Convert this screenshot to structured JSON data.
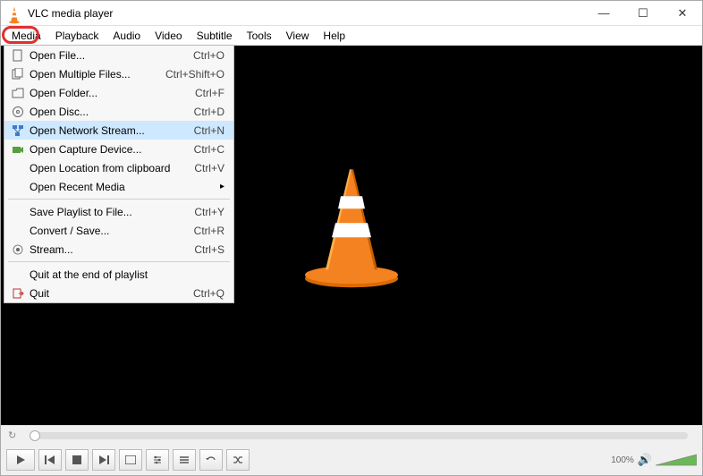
{
  "window": {
    "title": "VLC media player"
  },
  "menubar": {
    "items": [
      {
        "label": "Media",
        "active": true
      },
      {
        "label": "Playback"
      },
      {
        "label": "Audio"
      },
      {
        "label": "Video"
      },
      {
        "label": "Subtitle"
      },
      {
        "label": "Tools"
      },
      {
        "label": "View"
      },
      {
        "label": "Help"
      }
    ]
  },
  "dropdown": {
    "open_file": {
      "label": "Open File...",
      "shortcut": "Ctrl+O"
    },
    "open_multiple": {
      "label": "Open Multiple Files...",
      "shortcut": "Ctrl+Shift+O"
    },
    "open_folder": {
      "label": "Open Folder...",
      "shortcut": "Ctrl+F"
    },
    "open_disc": {
      "label": "Open Disc...",
      "shortcut": "Ctrl+D"
    },
    "open_network": {
      "label": "Open Network Stream...",
      "shortcut": "Ctrl+N",
      "selected": true
    },
    "open_capture": {
      "label": "Open Capture Device...",
      "shortcut": "Ctrl+C"
    },
    "open_clipboard": {
      "label": "Open Location from clipboard",
      "shortcut": "Ctrl+V"
    },
    "open_recent": {
      "label": "Open Recent Media"
    },
    "save_playlist": {
      "label": "Save Playlist to File...",
      "shortcut": "Ctrl+Y"
    },
    "convert_save": {
      "label": "Convert / Save...",
      "shortcut": "Ctrl+R"
    },
    "stream": {
      "label": "Stream...",
      "shortcut": "Ctrl+S"
    },
    "quit_end": {
      "label": "Quit at the end of playlist"
    },
    "quit": {
      "label": "Quit",
      "shortcut": "Ctrl+Q"
    }
  },
  "controls": {
    "volume_label": "100%"
  },
  "highlights": {
    "media_menu": true,
    "open_network_item": true
  }
}
